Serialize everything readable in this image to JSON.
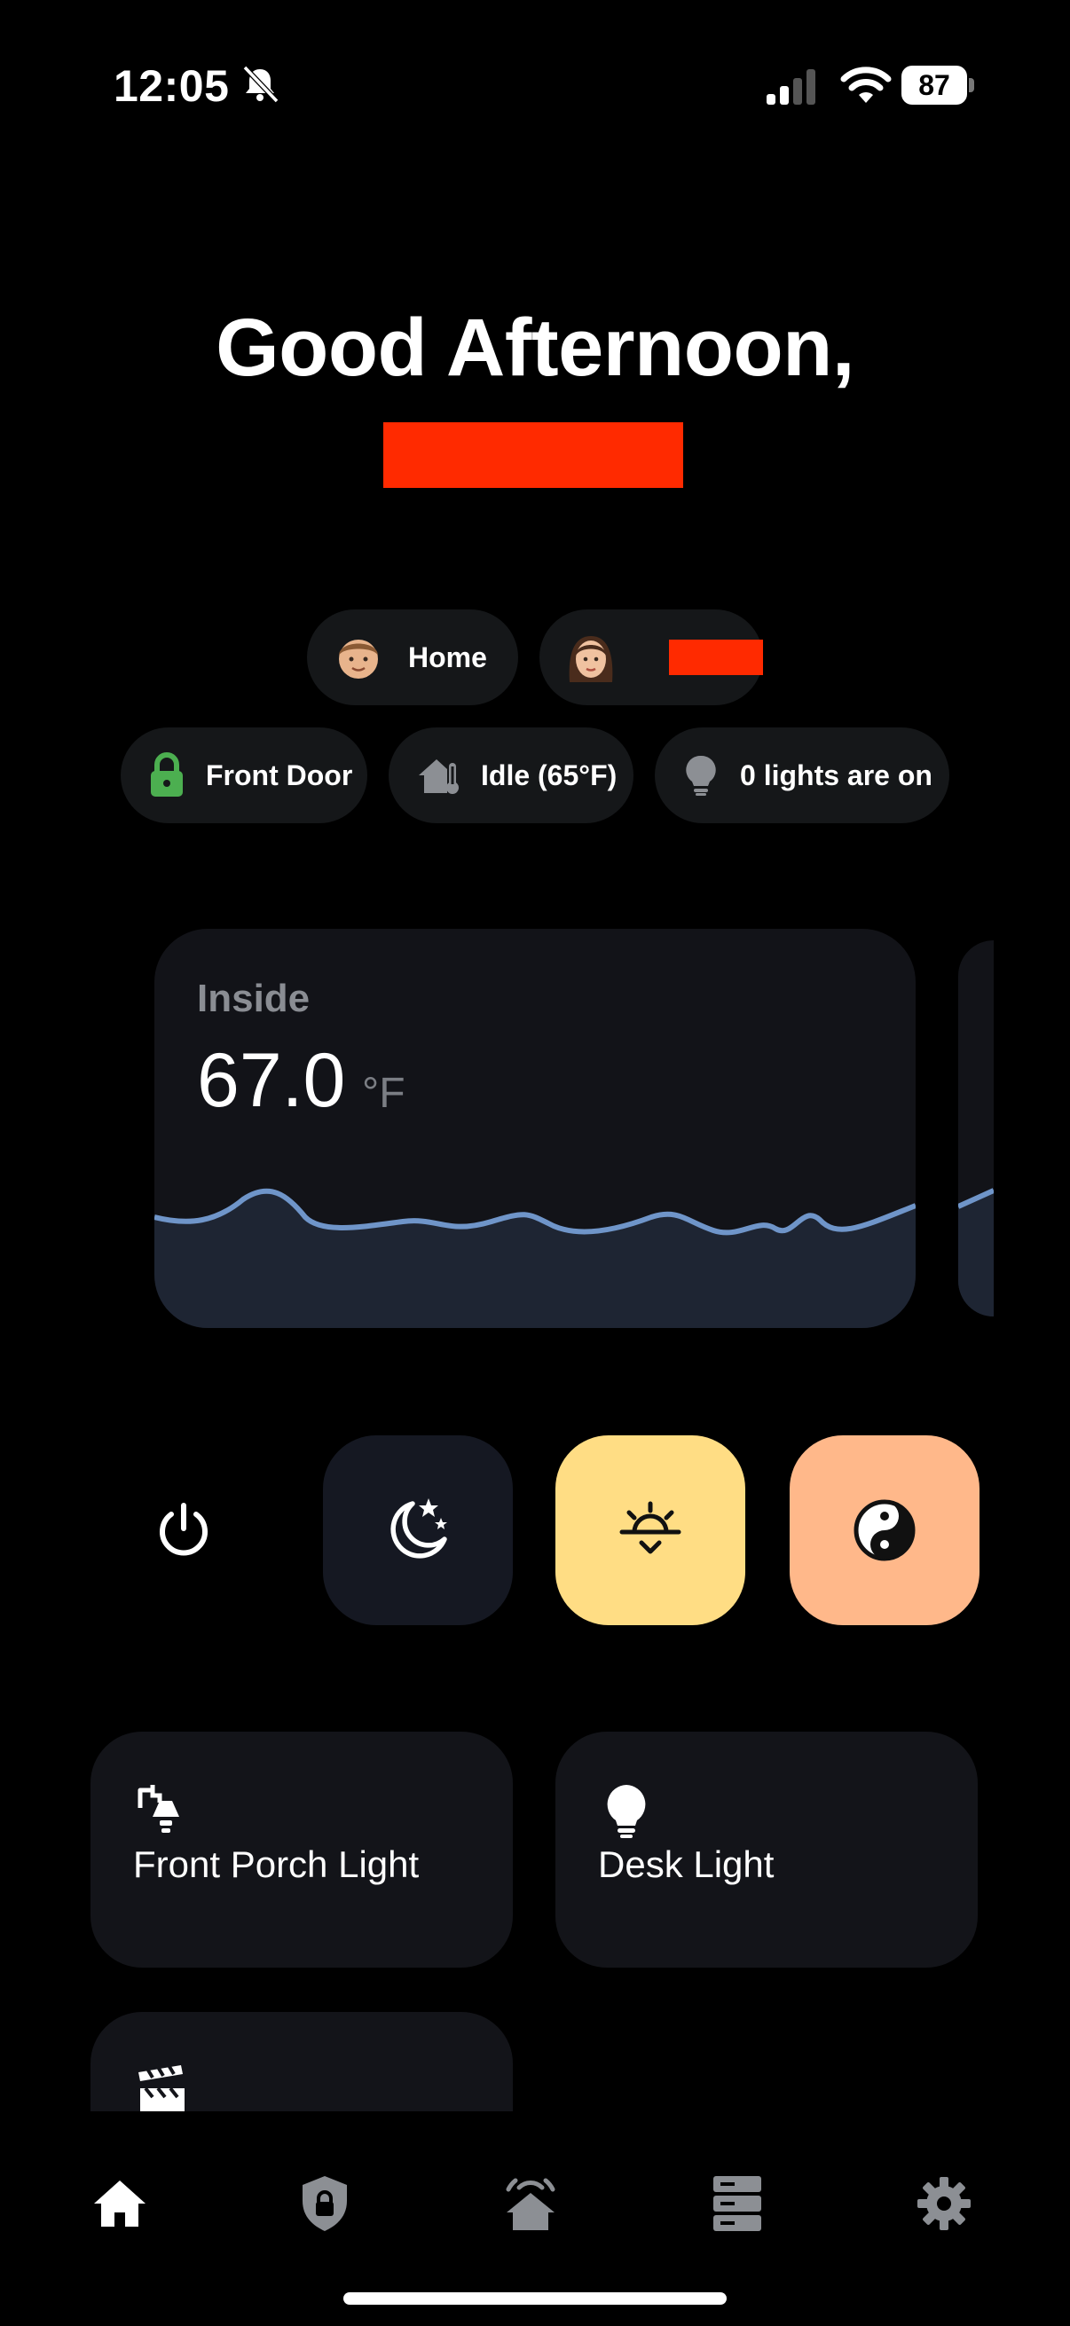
{
  "status_bar": {
    "time": "12:05",
    "battery": "87"
  },
  "greeting": {
    "text": "Good Afternoon,"
  },
  "people": [
    {
      "label": "Home",
      "icon": "man-avatar-icon"
    },
    {
      "label": "",
      "icon": "woman-avatar-icon"
    }
  ],
  "status_pills": {
    "front_door": "Front Door",
    "hvac": "Idle (65°F)",
    "lights": "0 lights are on"
  },
  "temperature": {
    "label": "Inside",
    "value": "67.0",
    "unit": "°F"
  },
  "scenes": [
    {
      "icon": "power-icon"
    },
    {
      "icon": "night-icon"
    },
    {
      "icon": "sunrise-icon"
    },
    {
      "icon": "yin-yang-icon"
    }
  ],
  "devices": [
    {
      "label": "Front Porch Light",
      "icon": "porch-light-icon"
    },
    {
      "label": "Desk Light",
      "icon": "lightbulb-icon"
    },
    {
      "label": "",
      "icon": "clapperboard-icon"
    }
  ],
  "nav": [
    "home-icon",
    "shield-icon",
    "house-alarm-icon",
    "server-icon",
    "gear-icon"
  ],
  "colors": {
    "background": "#000000",
    "card": "#121318",
    "lock_green": "#4caf50",
    "graph_line": "#6f95c9",
    "graph_fill": "#1e2533",
    "day_scene": "#ffdd84",
    "balance_scene": "#ffb88a",
    "redaction": "#ff2a00"
  }
}
